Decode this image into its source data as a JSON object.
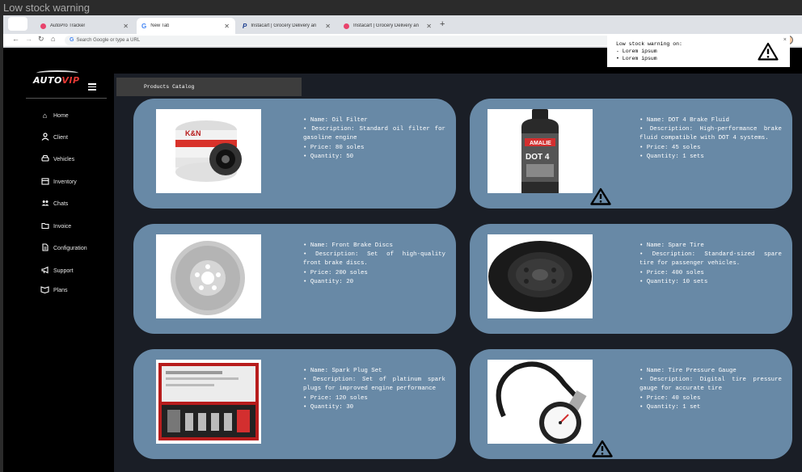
{
  "window": {
    "title": "Low stock warning"
  },
  "browser": {
    "tabs": [
      {
        "label": "",
        "favicon": "blank"
      },
      {
        "label": "AutoPro Tracker",
        "favicon": "dot-pink",
        "color": "#e8436c"
      },
      {
        "label": "New Tab",
        "favicon": "google-g"
      },
      {
        "label": "Instacart | Grocery Delivery an",
        "favicon": "paypal-p"
      },
      {
        "label": "Instacart | Grocery Delivery an",
        "favicon": "dot-pink",
        "color": "#e8436c"
      }
    ],
    "omnibox_placeholder": "Search Google or type a URL"
  },
  "popup": {
    "title": "Low stock warning on:",
    "items": [
      "- Lorem ipsum",
      "• Lorem ipsum"
    ],
    "icon": "warning-triangle-icon"
  },
  "sidebar": {
    "logo": {
      "part1": "AUTO",
      "part2": "VIP"
    },
    "items": [
      {
        "label": "Home",
        "icon": "home-icon"
      },
      {
        "label": "Client",
        "icon": "user-icon"
      },
      {
        "label": "Vehicles",
        "icon": "car-icon"
      },
      {
        "label": "Inventory",
        "icon": "calendar-icon"
      },
      {
        "label": "Chats",
        "icon": "people-icon"
      },
      {
        "label": "Invoice",
        "icon": "folder-icon"
      },
      {
        "label": "Configuration",
        "icon": "document-icon"
      },
      {
        "label": "Support",
        "icon": "megaphone-icon"
      },
      {
        "label": "Plans",
        "icon": "box-icon"
      }
    ]
  },
  "catalog": {
    "header": "Products Catalog",
    "products": [
      {
        "name": "• Name: Oil Filter",
        "description": "• Description: Standard oil filter for gasoline engine",
        "price": "• Price: 80 soles",
        "quantity": "• Quantity: 50",
        "image": "oil-filter-image",
        "low_stock": false
      },
      {
        "name": "• Name: DOT 4 Brake Fluid",
        "description": "• Description: High-performance brake fluid compatible with DOT 4 systems.",
        "price": "• Price: 45 soles",
        "quantity": "• Quantity: 1 sets",
        "image": "brake-fluid-image",
        "low_stock": true
      },
      {
        "name": "• Name: Front Brake Discs",
        "description": "• Description: Set of high-quality front brake discs.",
        "price": "• Price: 200 soles",
        "quantity": "• Quantity: 20",
        "image": "brake-disc-image",
        "low_stock": false
      },
      {
        "name": "• Name: Spare Tire",
        "description": "• Description: Standard-sized spare tire for passenger vehicles.",
        "price": "• Price: 400 soles",
        "quantity": "• Quantity: 10 sets",
        "image": "spare-tire-image",
        "low_stock": false
      },
      {
        "name": "• Name:  Spark Plug Set",
        "description": "• Description: Set of platinum spark plugs for improved engine performance",
        "price": "• Price: 120 soles",
        "quantity": "• Quantity: 30",
        "image": "spark-plug-set-image",
        "low_stock": false
      },
      {
        "name": "• Name: Tire Pressure Gauge",
        "description": "• Description: Digital tire pressure gauge for accurate tire",
        "price": "• Price: 40 soles",
        "quantity": "• Quantity: 1 set",
        "image": "pressure-gauge-image",
        "low_stock": true
      }
    ]
  },
  "colors": {
    "card": "#6889a6",
    "main_bg": "#1a1e26",
    "accent_red": "#e53935"
  }
}
